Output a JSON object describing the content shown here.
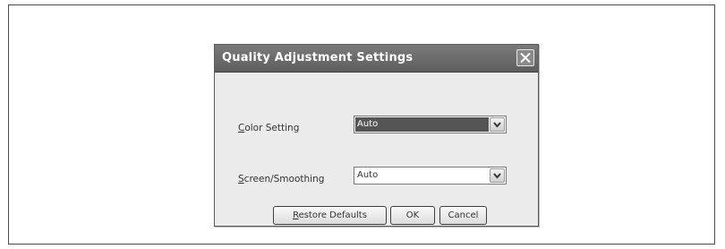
{
  "dialog": {
    "title": "Quality Adjustment Settings",
    "close_icon": "close-icon"
  },
  "color_setting": {
    "label_mnemonic": "C",
    "label_rest": "olor Setting",
    "value": "Auto"
  },
  "screen_smoothing": {
    "label_mnemonic": "S",
    "label_rest": "creen/Smoothing",
    "value": "Auto"
  },
  "buttons": {
    "restore_mnemonic": "R",
    "restore_rest": "estore Defaults",
    "ok": "OK",
    "cancel": "Cancel"
  },
  "colors": {
    "titlebar": "#6b6b6b",
    "dialog_bg": "#ebebeb",
    "selected_field": "#555555"
  }
}
